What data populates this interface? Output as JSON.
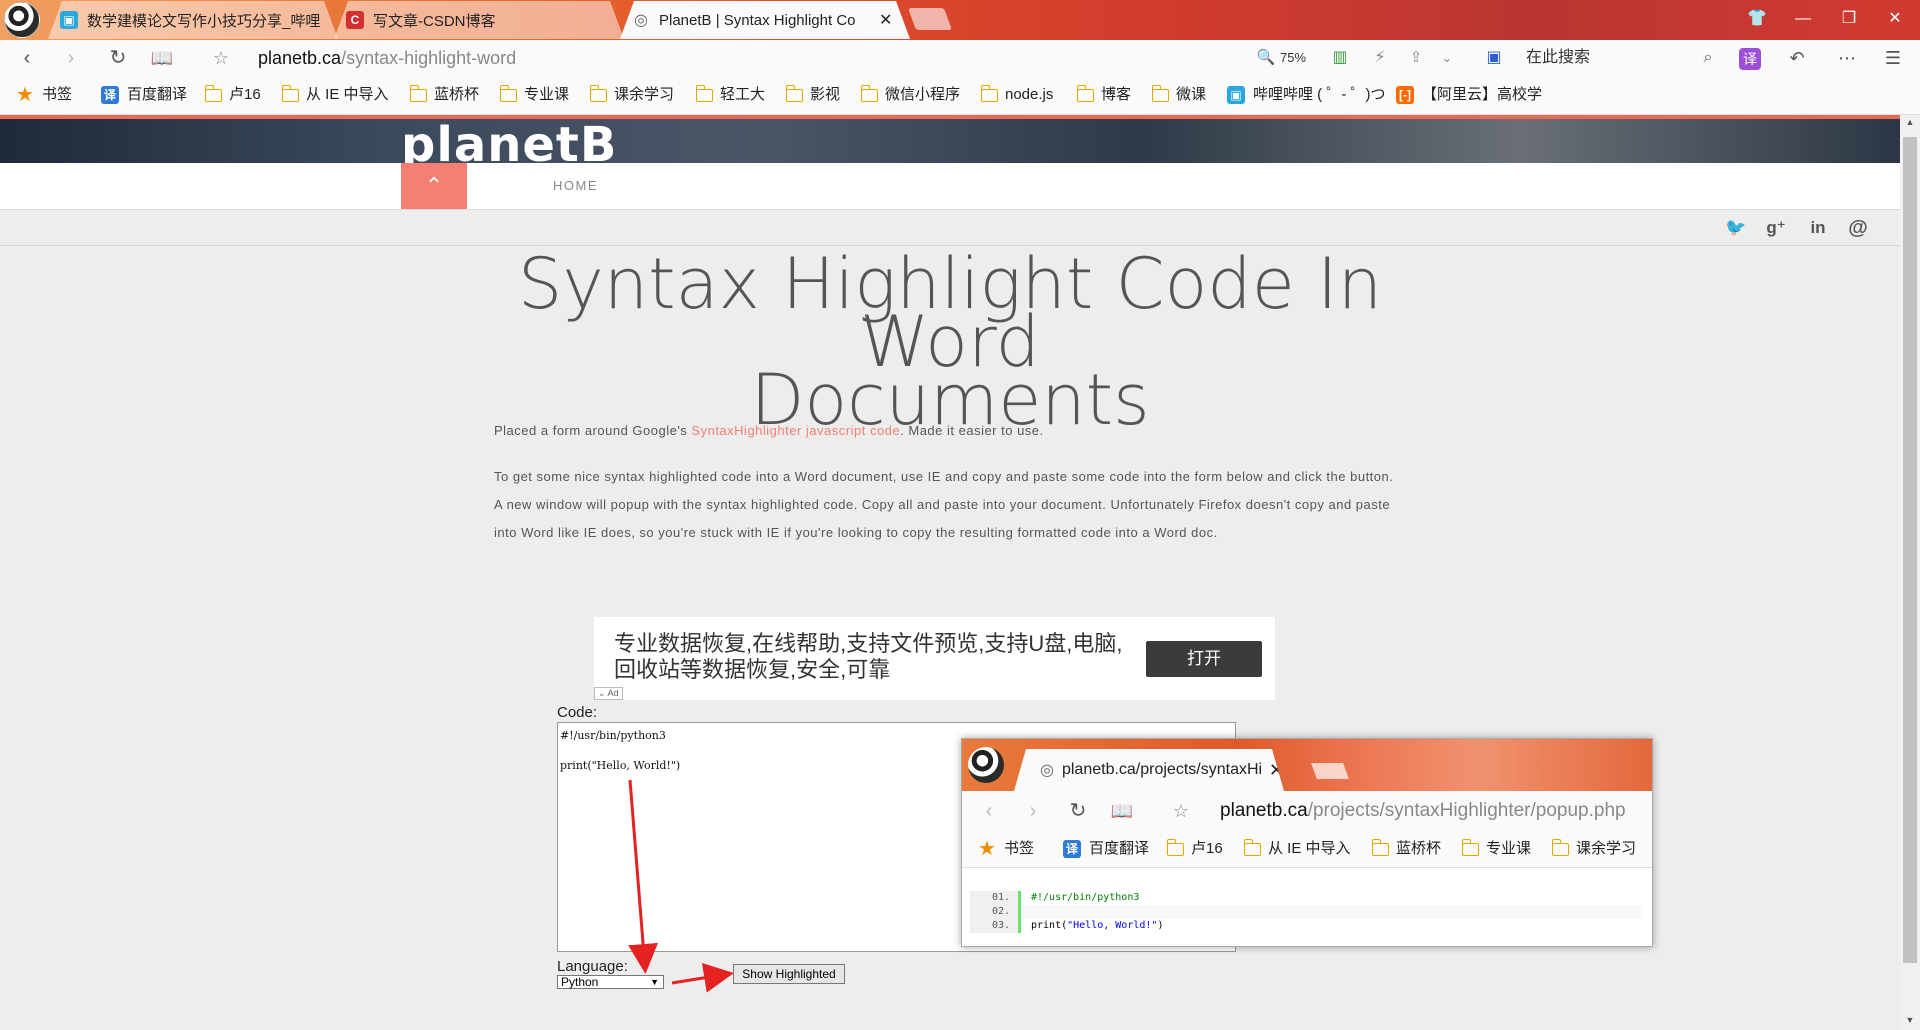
{
  "browser": {
    "tabs": [
      {
        "title": "数学建模论文写作小技巧分享_哔哩",
        "icon": "bilibili-icon"
      },
      {
        "title": "写文章-CSDN博客",
        "icon": "csdn-icon"
      },
      {
        "title": "PlanetB | Syntax Highlight Co",
        "icon": "globe-icon",
        "active": true
      }
    ],
    "url_host": "planetb.ca",
    "url_path": "/syntax-highlight-word",
    "zoom": "75%",
    "search_placeholder": "在此搜索",
    "translate_label": "译"
  },
  "bookmarks": [
    {
      "label": "书签",
      "icon": "star-icon"
    },
    {
      "label": "百度翻译",
      "icon": "translate-icon"
    },
    {
      "label": "卢16",
      "icon": "folder-icon"
    },
    {
      "label": "从 IE 中导入",
      "icon": "folder-icon"
    },
    {
      "label": "蓝桥杯",
      "icon": "folder-icon"
    },
    {
      "label": "专业课",
      "icon": "folder-icon"
    },
    {
      "label": "课余学习",
      "icon": "folder-icon"
    },
    {
      "label": "轻工大",
      "icon": "folder-icon"
    },
    {
      "label": "影视",
      "icon": "folder-icon"
    },
    {
      "label": "微信小程序",
      "icon": "folder-icon"
    },
    {
      "label": "node.js",
      "icon": "folder-icon"
    },
    {
      "label": "博客",
      "icon": "folder-icon"
    },
    {
      "label": "微课",
      "icon": "folder-icon"
    },
    {
      "label": "哔哩哔哩 ( ゜- ゜)つ",
      "icon": "bilibili-icon"
    },
    {
      "label": "【阿里云】高校学",
      "icon": "aliyun-icon"
    }
  ],
  "site": {
    "logo": "planetB",
    "nav_home": "HOME",
    "social": [
      "twitter-icon",
      "google-plus-icon",
      "linkedin-icon",
      "at-icon"
    ]
  },
  "article": {
    "title_line1": "Syntax Highlight Code In Word",
    "title_line2": "Documents",
    "intro_before": "Placed a form around Google's ",
    "intro_link": "SyntaxHighlighter javascript code",
    "intro_after": ". Made it easier to use.",
    "body": "To get some nice syntax highlighted code into a Word document, use IE and copy and paste some code into the form below and click the button. A new window will popup with the syntax highlighted code. Copy all and paste into your document. Unfortunately Firefox doesn't copy and paste into Word like IE does, so you're stuck with IE if you're looking to copy the resulting formatted code into a Word doc."
  },
  "ad": {
    "text": "专业数据恢复,在线帮助,支持文件预览,支持U盘,电脑,回收站等数据恢复,安全,可靠",
    "button": "打开",
    "mark": "Ad"
  },
  "form": {
    "code_label": "Code:",
    "code_value": "#!/usr/bin/python3\n\nprint(\"Hello, World!\")",
    "language_label": "Language:",
    "language_value": "Python",
    "submit_label": "Show Highlighted"
  },
  "popup": {
    "tab_title": "planetb.ca/projects/syntaxHi",
    "url_host": "planetb.ca",
    "url_path": "/projects/syntaxHighlighter/popup.php",
    "bookmarks": [
      "书签",
      "百度翻译",
      "卢16",
      "从 IE 中导入",
      "蓝桥杯",
      "专业课",
      "课余学习"
    ],
    "lines": [
      {
        "num": "01.",
        "code": "#!/usr/bin/python3"
      },
      {
        "num": "02.",
        "code": ""
      },
      {
        "num": "03.",
        "code_fn": "print(",
        "code_str": "\"Hello, World!\"",
        "code_end": ")"
      }
    ]
  }
}
